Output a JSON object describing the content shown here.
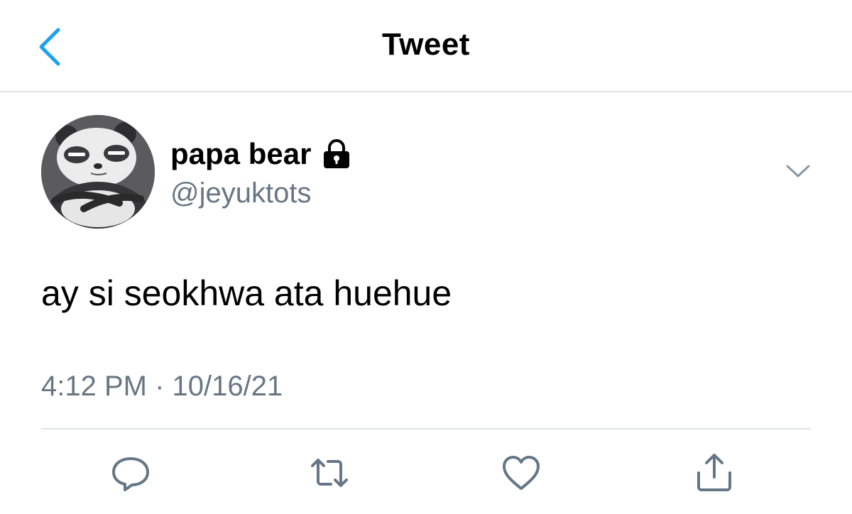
{
  "header": {
    "title": "Tweet",
    "back_icon": "chevron-left-icon",
    "accent_color": "#1da1f2"
  },
  "tweet": {
    "author": {
      "name": "papa bear",
      "handle": "@jeyuktots",
      "protected_icon": "lock-icon"
    },
    "text": "ay si seokhwa ata huehue",
    "timestamp": "4:12 PM · 10/16/21"
  },
  "actions": [
    {
      "icon": "reply-icon"
    },
    {
      "icon": "retweet-icon"
    },
    {
      "icon": "like-icon"
    },
    {
      "icon": "share-icon"
    }
  ],
  "colors": {
    "secondary_text": "#687684",
    "icon_gray": "#657786",
    "divider": "#dfe3e6"
  }
}
